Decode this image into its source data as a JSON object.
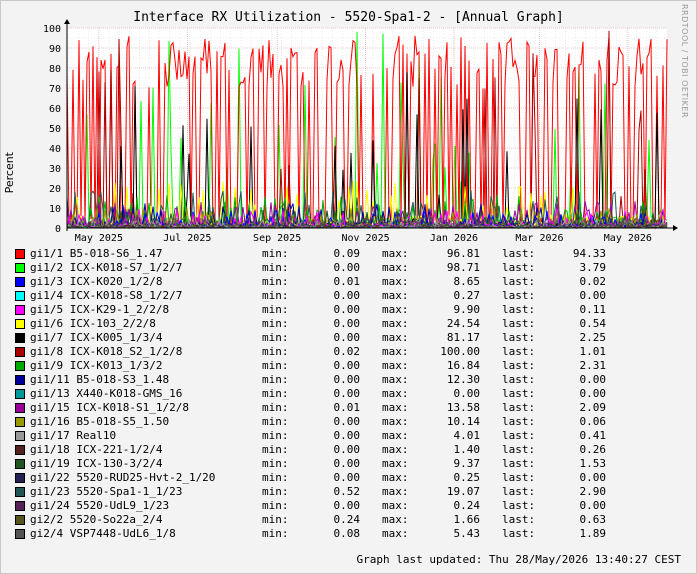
{
  "title": "Interface RX Utilization - 5520-Spa1-2 - [Annual Graph]",
  "watermark": "RRDTOOL / TOBI OETIKER",
  "updated": "Graph last updated: Thu 28/May/2026 13:40:27 CEST",
  "labels": {
    "min": "min:",
    "max": "max:",
    "last": "last:"
  },
  "colors": {
    "background": "#f3f3f3",
    "plot_bg": "#ffffff",
    "grid_major": "#e0a0a0",
    "grid_minor": "#dddddd"
  },
  "chart_data": {
    "type": "line",
    "title": "Interface RX Utilization - 5520-Spa1-2 - [Annual Graph]",
    "ylabel": "Percent",
    "ylim": [
      0,
      100
    ],
    "yticks": [
      0,
      10,
      20,
      30,
      40,
      50,
      60,
      70,
      80,
      90,
      100
    ],
    "x_start": "2025-04-09",
    "x_end": "2026-05-28",
    "xticks": [
      {
        "date": "2025-05-01",
        "label": "May 2025"
      },
      {
        "date": "2025-07-01",
        "label": "Jul 2025"
      },
      {
        "date": "2025-09-01",
        "label": "Sep 2025"
      },
      {
        "date": "2025-11-01",
        "label": "Nov 2025"
      },
      {
        "date": "2026-01-01",
        "label": "Jan 2026"
      },
      {
        "date": "2026-03-01",
        "label": "Mar 2026"
      },
      {
        "date": "2026-05-01",
        "label": "May 2026"
      }
    ],
    "grid": true,
    "series": [
      {
        "name": "gi1/1 B5-018-S6_1.47",
        "color": "#ff0000",
        "min": "0.09",
        "max": "96.81",
        "last": "94.33"
      },
      {
        "name": "gi1/2 ICX-K018-S7_1/2/7",
        "color": "#00ff00",
        "min": "0.00",
        "max": "98.71",
        "last": "3.79"
      },
      {
        "name": "gi1/3 ICX-K020_1/2/8",
        "color": "#0000ff",
        "min": "0.01",
        "max": "8.65",
        "last": "0.02"
      },
      {
        "name": "gi1/4 ICX-K018-S8_1/2/7",
        "color": "#00ffff",
        "min": "0.00",
        "max": "0.27",
        "last": "0.00"
      },
      {
        "name": "gi1/5 ICX-K29-1_2/2/8",
        "color": "#ff00ff",
        "min": "0.00",
        "max": "9.90",
        "last": "0.11"
      },
      {
        "name": "gi1/6 ICX-103_2/2/8",
        "color": "#ffff00",
        "min": "0.00",
        "max": "24.54",
        "last": "0.54"
      },
      {
        "name": "gi1/7 ICX-K005_1/3/4",
        "color": "#000000",
        "min": "0.00",
        "max": "81.17",
        "last": "2.25"
      },
      {
        "name": "gi1/8 ICX-K018_S2_1/2/8",
        "color": "#aa0000",
        "min": "0.02",
        "max": "100.00",
        "last": "1.01"
      },
      {
        "name": "gi1/9 ICX-K013_1/3/2",
        "color": "#00aa00",
        "min": "0.00",
        "max": "16.84",
        "last": "2.31"
      },
      {
        "name": "gi1/11 B5-018-S3_1.48",
        "color": "#000099",
        "min": "0.00",
        "max": "12.30",
        "last": "0.00"
      },
      {
        "name": "gi1/13 X440-K018-GMS_16",
        "color": "#009999",
        "min": "0.00",
        "max": "0.00",
        "last": "0.00"
      },
      {
        "name": "gi1/15 ICX-K018-S1_1/2/8",
        "color": "#990099",
        "min": "0.01",
        "max": "13.58",
        "last": "2.09"
      },
      {
        "name": "gi1/16 B5-018-S5_1.50",
        "color": "#999900",
        "min": "0.00",
        "max": "10.14",
        "last": "0.06"
      },
      {
        "name": "gi1/17 Real10",
        "color": "#999999",
        "min": "0.00",
        "max": "4.01",
        "last": "0.41"
      },
      {
        "name": "gi1/18 ICX-221-1/2/4",
        "color": "#552222",
        "min": "0.00",
        "max": "1.40",
        "last": "0.26"
      },
      {
        "name": "gi1/19 ICX-130-3/2/4",
        "color": "#225522",
        "min": "0.00",
        "max": "9.37",
        "last": "1.53"
      },
      {
        "name": "gi1/22 5520-RUD25-Hvt-2_1/20",
        "color": "#222255",
        "min": "0.00",
        "max": "0.25",
        "last": "0.00"
      },
      {
        "name": "gi1/23 5520-Spa1-1_1/23",
        "color": "#225555",
        "min": "0.52",
        "max": "19.07",
        "last": "2.90"
      },
      {
        "name": "gi1/24 5520-UdL9_1/23",
        "color": "#552255",
        "min": "0.00",
        "max": "0.24",
        "last": "0.00"
      },
      {
        "name": "gi2/2 5520-So22a_2/4",
        "color": "#555522",
        "min": "0.24",
        "max": "1.66",
        "last": "0.63"
      },
      {
        "name": "gi2/4 VSP7448-UdL6_1/8",
        "color": "#555555",
        "min": "0.08",
        "max": "5.43",
        "last": "1.89"
      }
    ]
  }
}
